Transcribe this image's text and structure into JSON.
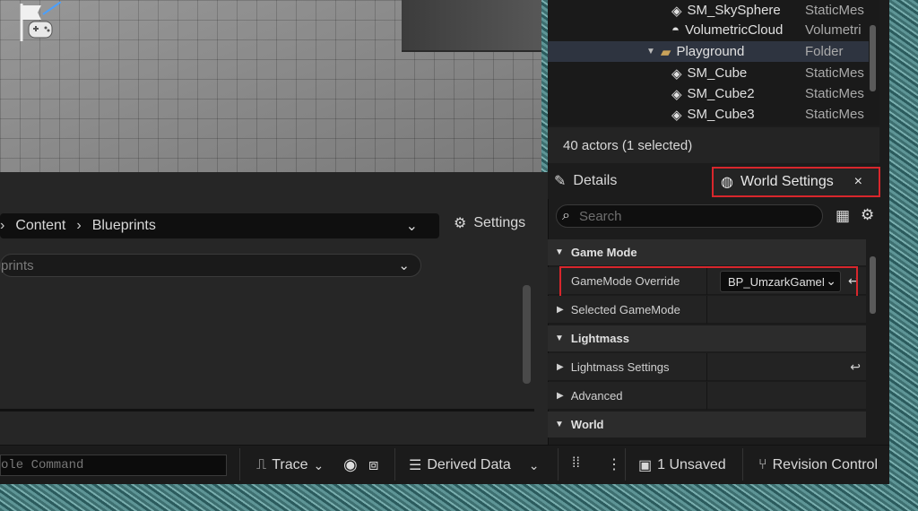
{
  "outliner": {
    "rows": [
      {
        "name": "SM_SkySphere",
        "type": "StaticMes",
        "icon": "static-mesh-icon"
      },
      {
        "name": "VolumetricCloud",
        "type": "Volumetri",
        "icon": "cloud-icon"
      },
      {
        "name": "Playground",
        "type": "Folder",
        "icon": "folder-icon"
      },
      {
        "name": "SM_Cube",
        "type": "StaticMes",
        "icon": "static-mesh-icon"
      },
      {
        "name": "SM_Cube2",
        "type": "StaticMes",
        "icon": "static-mesh-icon"
      },
      {
        "name": "SM_Cube3",
        "type": "StaticMes",
        "icon": "static-mesh-icon"
      }
    ],
    "count_text": "40 actors (1 selected)"
  },
  "tabs": {
    "details": "Details",
    "world_settings": "World Settings",
    "close": "×"
  },
  "details": {
    "search_placeholder": "Search",
    "categories": {
      "game_mode": "Game Mode",
      "lightmass": "Lightmass",
      "world": "World"
    },
    "props": {
      "gamemode_override": "GameMode Override",
      "gamemode_value": "BP_UmzarkGameM",
      "selected_gamemode": "Selected GameMode",
      "lightmass_settings": "Lightmass Settings",
      "advanced": "Advanced"
    }
  },
  "content_browser": {
    "path": [
      "Content",
      "Blueprints"
    ],
    "settings_label": "Settings",
    "filter_text": "prints"
  },
  "statusbar": {
    "cmd_placeholder": "ole Command",
    "trace": "Trace",
    "derived_data": "Derived Data",
    "unsaved": "1 Unsaved",
    "revision_control": "Revision Control"
  },
  "colors": {
    "highlight_red": "#d8262c",
    "panel_bg": "#1c1c1c",
    "folder_yellow": "#c9a35a"
  }
}
